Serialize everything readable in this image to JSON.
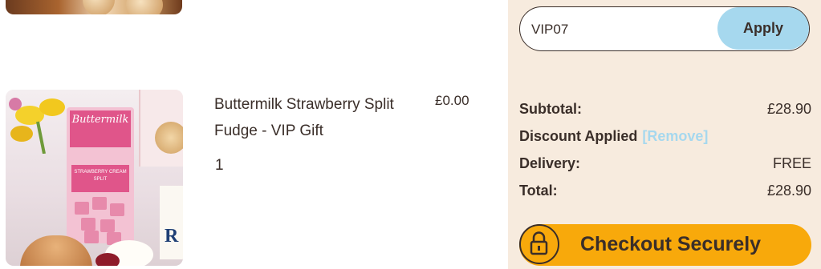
{
  "product": {
    "name_line1": "Buttermilk Strawberry Split",
    "name_line2": "Fudge - VIP Gift",
    "price": "£0.00",
    "quantity": "1",
    "packaging_brand": "Buttermilk",
    "packaging_flavour": "STRAWBERRY CREAM SPLIT"
  },
  "promo": {
    "code_value": "VIP07",
    "apply_label": "Apply"
  },
  "summary": {
    "subtotal_label": "Subtotal:",
    "subtotal_value": "£28.90",
    "discount_label": "Discount Applied",
    "remove_label": "[Remove]",
    "delivery_label": "Delivery:",
    "delivery_value": "FREE",
    "total_label": "Total:",
    "total_value": "£28.90"
  },
  "checkout": {
    "label": "Checkout Securely",
    "icon": "lock-icon"
  },
  "colors": {
    "panel_bg": "#f7ebde",
    "apply_bg": "#a6d8ee",
    "checkout_bg": "#f8a90b",
    "text": "#3a2e29",
    "link": "#a6d8ee"
  }
}
